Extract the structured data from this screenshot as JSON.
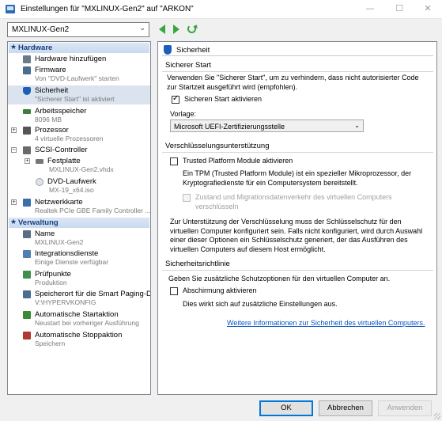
{
  "window": {
    "title": "Einstellungen für \"MXLINUX-Gen2\" auf \"ARKON\"",
    "minimize": "—",
    "maximize": "☐",
    "close": "✕"
  },
  "toolbar": {
    "vm_selected": "MXLINUX-Gen2"
  },
  "tree": {
    "hardware_header": "Hardware",
    "management_header": "Verwaltung",
    "hardware_items": [
      {
        "label": "Hardware hinzufügen",
        "sub": "",
        "icon": "add-hardware-icon",
        "color": "#6b7a89"
      },
      {
        "label": "Firmware",
        "sub": "Von \"DVD-Laufwerk\" starten",
        "icon": "firmware-icon",
        "color": "#4a6c91"
      },
      {
        "label": "Sicherheit",
        "sub": "\"Sicherer Start\" ist aktiviert",
        "icon": "shield-icon",
        "color": "#1d5fb8"
      },
      {
        "label": "Arbeitsspeicher",
        "sub": "8096 MB",
        "icon": "memory-icon",
        "color": "#3f7d3a"
      },
      {
        "label": "Prozessor",
        "sub": "4 virtuelle Prozessoren",
        "icon": "processor-icon",
        "color": "#555555"
      },
      {
        "label": "SCSI-Controller",
        "sub": "",
        "icon": "scsi-icon",
        "color": "#6a6a6a"
      },
      {
        "label": "Festplatte",
        "sub": "MXLINUX-Gen2.vhdx",
        "icon": "hard-disk-icon",
        "color": "#777777"
      },
      {
        "label": "DVD-Laufwerk",
        "sub": "MX-19_x64.iso",
        "icon": "dvd-icon",
        "color": "#9aa3ad"
      },
      {
        "label": "Netzwerkkarte",
        "sub": "Realtek PCIe GBE Family Controller ...",
        "icon": "network-icon",
        "color": "#3b6fa8"
      }
    ],
    "management_items": [
      {
        "label": "Name",
        "sub": "MXLINUX-Gen2",
        "icon": "name-icon",
        "color": "#5a6d86"
      },
      {
        "label": "Integrationsdienste",
        "sub": "Einige Dienste verfügbar",
        "icon": "integration-icon",
        "color": "#4f7fb5"
      },
      {
        "label": "Prüfpunkte",
        "sub": "Produktion",
        "icon": "checkpoint-icon",
        "color": "#3f8f4a"
      },
      {
        "label": "Speicherort für die Smart Paging-D...",
        "sub": "V:\\HYPERVKONFIG",
        "icon": "paging-icon",
        "color": "#4a6c91"
      },
      {
        "label": "Automatische Startaktion",
        "sub": "Neustart bei vorheriger Ausführung",
        "icon": "autostart-icon",
        "color": "#3a8a3a"
      },
      {
        "label": "Automatische Stoppaktion",
        "sub": "Speichern",
        "icon": "autostop-icon",
        "color": "#b03a2e"
      }
    ]
  },
  "pane": {
    "title": "Sicherheit",
    "secure_boot": {
      "title": "Sicherer Start",
      "description": "Verwenden Sie \"Sicherer Start\", um zu verhindern, dass nicht autorisierter Code zur Startzeit ausgeführt wird (empfohlen).",
      "checkbox_label": "Sicheren Start aktivieren",
      "template_label": "Vorlage:",
      "template_value": "Microsoft UEFI-Zertifizierungsstelle"
    },
    "encryption": {
      "title": "Verschlüsselungsunterstützung",
      "tpm_label": "Trusted Platform Module aktivieren",
      "tpm_description": "Ein TPM (Trusted Platform Module) ist ein spezieller Mikroprozessor, der Kryptografiedienste für ein Computersystem bereitstellt.",
      "state_label": "Zustand und Migrationsdatenverkehr des virtuellen Computers verschlüsseln",
      "info": "Zur Unterstützung der Verschlüsselung muss der Schlüsselschutz für den virtuellen Computer konfiguriert sein. Falls nicht konfiguriert, wird durch Auswahl einer dieser Optionen ein Schlüsselschutz generiert, der das Ausführen des virtuellen Computers auf diesem Host ermöglicht."
    },
    "policy": {
      "title": "Sicherheitsrichtlinie",
      "description": "Geben Sie zusätzliche Schutzoptionen für den virtuellen Computer an.",
      "shielding_label": "Abschirmung aktivieren",
      "shielding_note": "Dies wirkt sich auf zusätzliche Einstellungen aus."
    },
    "more_link": "Weitere Informationen zur Sicherheit des virtuellen Computers."
  },
  "buttons": {
    "ok": "OK",
    "cancel": "Abbrechen",
    "apply": "Anwenden"
  }
}
